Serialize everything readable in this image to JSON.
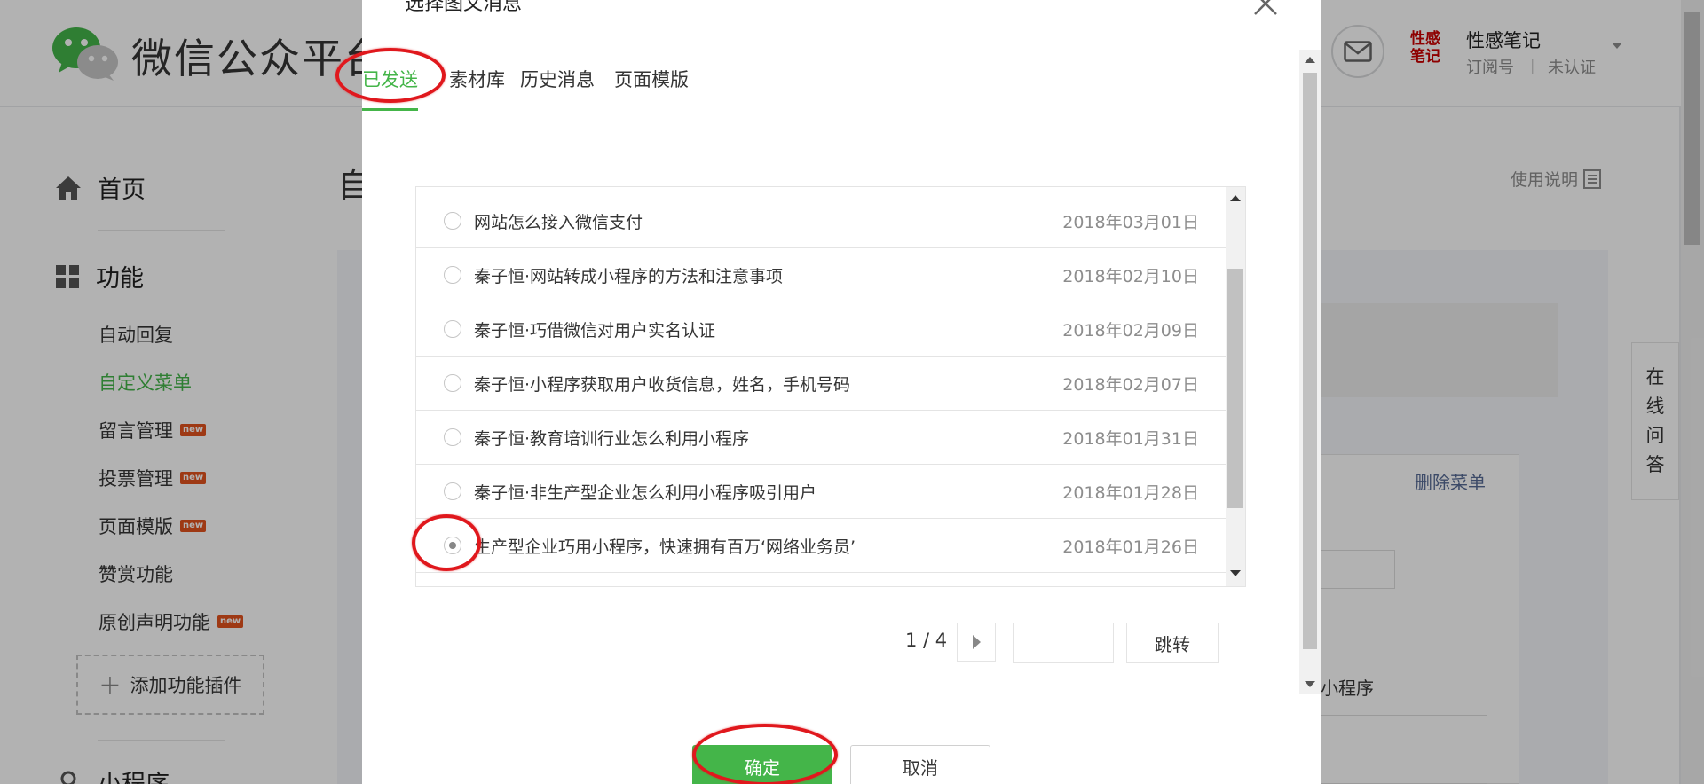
{
  "header": {
    "brand": "微信公众平台",
    "account": {
      "name": "性感笔记",
      "avatar_text": "性感笔记",
      "type": "订阅号",
      "separator": "|",
      "status": "未认证"
    }
  },
  "sidebar": {
    "home_label": "首页",
    "section_label": "功能",
    "items": [
      {
        "label": "自动回复",
        "active": false,
        "badge": ""
      },
      {
        "label": "自定义菜单",
        "active": true,
        "badge": ""
      },
      {
        "label": "留言管理",
        "active": false,
        "badge": "new"
      },
      {
        "label": "投票管理",
        "active": false,
        "badge": "new"
      },
      {
        "label": "页面模版",
        "active": false,
        "badge": "new"
      },
      {
        "label": "赞赏功能",
        "active": false,
        "badge": ""
      },
      {
        "label": "原创声明功能",
        "active": false,
        "badge": "new"
      }
    ],
    "add_plugin_label": "添加功能插件",
    "next_section_label": "小程序"
  },
  "main": {
    "page_title": "自",
    "help_label": "使用说明",
    "delete_menu_label": "删除菜单",
    "radio_label": "小程序",
    "online_qa": [
      "在",
      "线",
      "问",
      "答"
    ]
  },
  "dialog": {
    "title": "选择图文消息",
    "tabs": [
      {
        "label": "已发送",
        "active": true
      },
      {
        "label": "素材库",
        "active": false
      },
      {
        "label": "历史消息",
        "active": false
      },
      {
        "label": "页面模版",
        "active": false
      }
    ],
    "articles": [
      {
        "title": "网站怎么接入微信支付",
        "date": "2018年03月01日",
        "checked": false
      },
      {
        "title": "秦子恒·网站转成小程序的方法和注意事项",
        "date": "2018年02月10日",
        "checked": false
      },
      {
        "title": "秦子恒·巧借微信对用户实名认证",
        "date": "2018年02月09日",
        "checked": false
      },
      {
        "title": "秦子恒·小程序获取用户收货信息，姓名，手机号码",
        "date": "2018年02月07日",
        "checked": false
      },
      {
        "title": "秦子恒·教育培训行业怎么利用小程序",
        "date": "2018年01月31日",
        "checked": false
      },
      {
        "title": "秦子恒·非生产型企业怎么利用小程序吸引用户",
        "date": "2018年01月28日",
        "checked": false
      },
      {
        "title": "生产型企业巧用小程序，快速拥有百万‘网络业务员’",
        "date": "2018年01月26日",
        "checked": true
      }
    ],
    "pager": {
      "text": "1 / 4",
      "input_value": "",
      "jump_label": "跳转"
    },
    "confirm_label": "确定",
    "cancel_label": "取消"
  },
  "colors": {
    "accent": "#44b549",
    "highlight_ring": "#e0181d",
    "link": "#576b95"
  },
  "icons": [
    "wechat-logo",
    "mail-icon",
    "home-icon",
    "grid-icon",
    "help-doc-icon",
    "close-icon",
    "plus-icon",
    "chevron-right-icon",
    "caret-down-icon"
  ]
}
